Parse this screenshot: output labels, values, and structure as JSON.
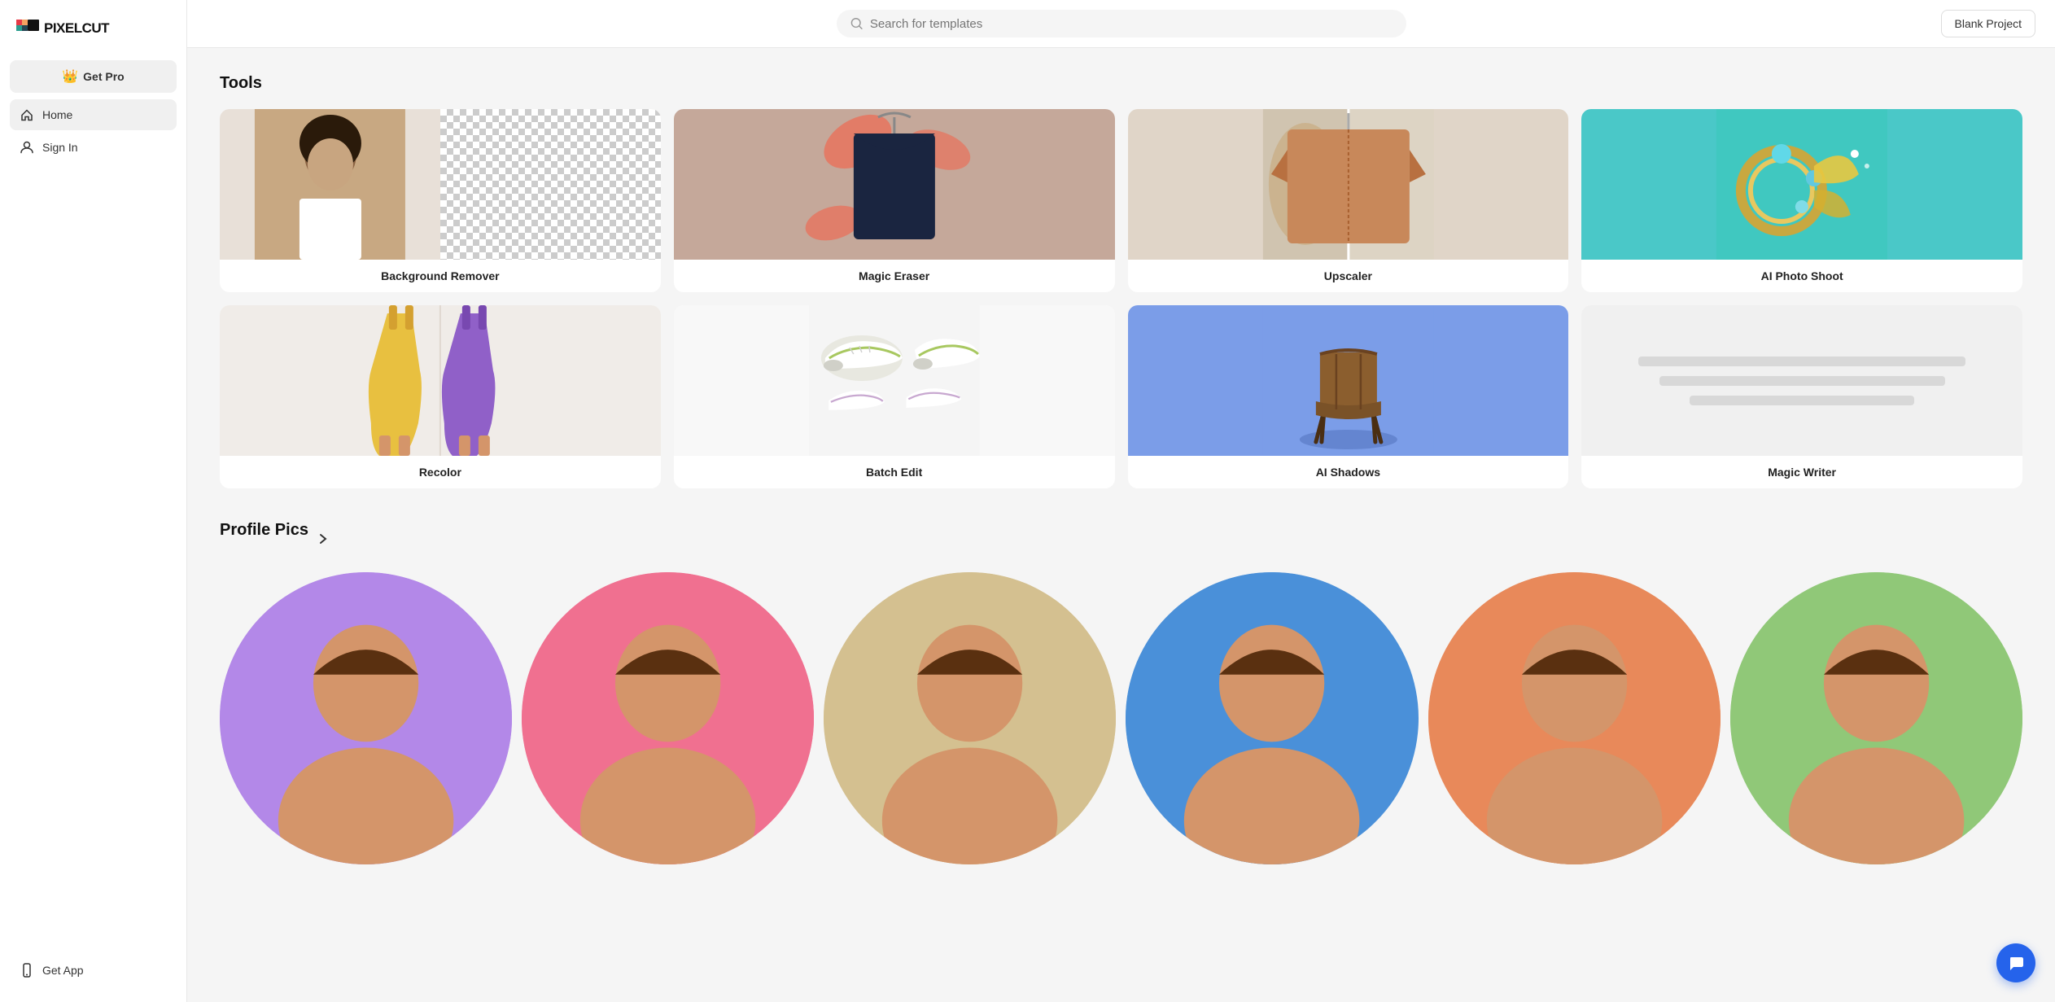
{
  "logo": {
    "text": "PIXELCUT"
  },
  "sidebar": {
    "get_pro_label": "Get Pro",
    "nav_items": [
      {
        "id": "home",
        "label": "Home",
        "icon": "home",
        "active": true
      },
      {
        "id": "sign-in",
        "label": "Sign In",
        "icon": "person",
        "active": false
      }
    ],
    "bottom_items": [
      {
        "id": "get-app",
        "label": "Get App",
        "icon": "phone"
      }
    ]
  },
  "header": {
    "search_placeholder": "Search for templates",
    "blank_project_label": "Blank Project"
  },
  "tools": {
    "section_title": "Tools",
    "items": [
      {
        "id": "background-remover",
        "label": "Background Remover",
        "type": "bg-remover"
      },
      {
        "id": "magic-eraser",
        "label": "Magic Eraser",
        "type": "magic-eraser"
      },
      {
        "id": "upscaler",
        "label": "Upscaler",
        "type": "upscaler"
      },
      {
        "id": "ai-photo-shoot",
        "label": "AI Photo Shoot",
        "type": "ai-photo"
      },
      {
        "id": "recolor",
        "label": "Recolor",
        "type": "recolor"
      },
      {
        "id": "batch-edit",
        "label": "Batch Edit",
        "type": "batch-edit"
      },
      {
        "id": "ai-shadows",
        "label": "AI Shadows",
        "type": "ai-shadows"
      },
      {
        "id": "magic-writer",
        "label": "Magic Writer",
        "type": "magic-writer"
      }
    ]
  },
  "profile_pics": {
    "section_title": "Profile Pics",
    "colors": [
      "#b388e8",
      "#f07090",
      "#d4c090",
      "#4a90d9",
      "#e8895a",
      "#90c878"
    ]
  },
  "chat_button": {
    "icon": "💬"
  }
}
